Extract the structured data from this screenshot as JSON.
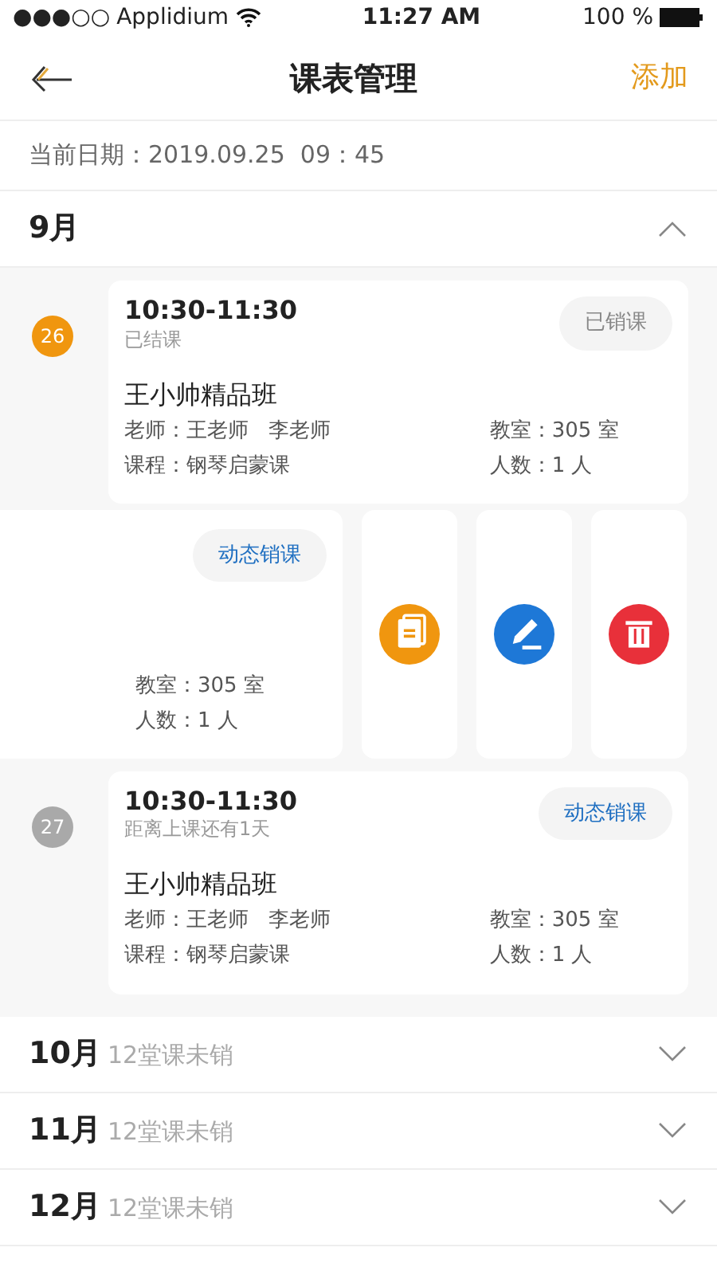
{
  "status_bar": {
    "signal": "●●●○○",
    "carrier": "Applidium",
    "time": "11:27 AM",
    "battery": "100 %"
  },
  "nav": {
    "title": "课表管理",
    "action": "添加"
  },
  "current_date": "当前日期：2019.09.25  09：45",
  "months": [
    {
      "label": "9月",
      "expanded": true,
      "lessons": [
        {
          "kind": "full",
          "day": "26",
          "day_active": true,
          "time": "10:30-11:30",
          "status": "已结课",
          "button": "已销课",
          "button_done": true,
          "class_name": "王小帅精品班",
          "teacher": "老师：王老师   李老师",
          "course": "课程：钢琴启蒙课",
          "room": "教室：305 室",
          "count": "人数：1 人"
        },
        {
          "kind": "swiped",
          "button": "动态销课",
          "button_done": false,
          "room": "教室：305 室",
          "count": "人数：1 人",
          "actions": [
            {
              "kind": "copy",
              "color": "#f0960f"
            },
            {
              "kind": "edit",
              "color": "#1e78d7"
            },
            {
              "kind": "delete",
              "color": "#e8303a"
            }
          ]
        },
        {
          "kind": "full",
          "day": "27",
          "day_active": false,
          "time": "10:30-11:30",
          "status": "距离上课还有1天",
          "button": "动态销课",
          "button_done": false,
          "class_name": "王小帅精品班",
          "teacher": "老师：王老师   李老师",
          "course": "课程：钢琴启蒙课",
          "room": "教室：305 室",
          "count": "人数：1 人"
        }
      ]
    },
    {
      "label": "10月",
      "expanded": false,
      "pending": "12堂课未销"
    },
    {
      "label": "11月",
      "expanded": false,
      "pending": "12堂课未销"
    },
    {
      "label": "12月",
      "expanded": false,
      "pending": "12堂课未销"
    }
  ]
}
